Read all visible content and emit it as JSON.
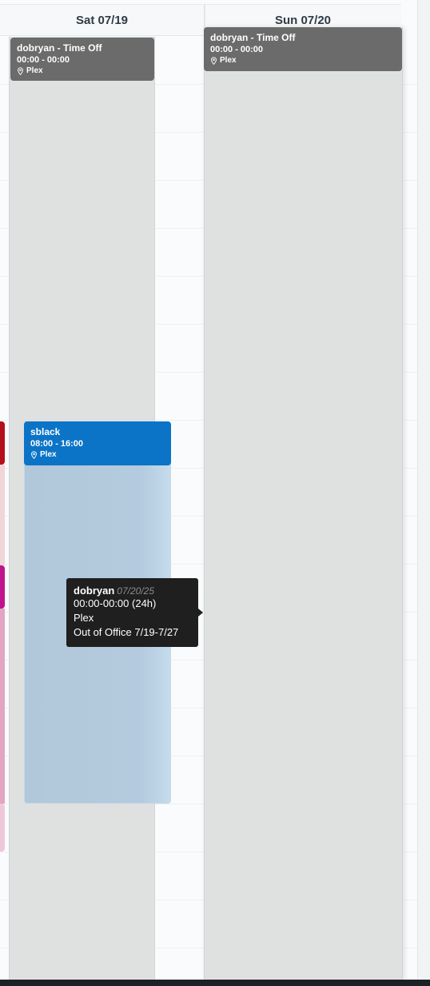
{
  "columns": [
    {
      "label": "Sat 07/19"
    },
    {
      "label": "Sun 07/20"
    }
  ],
  "events": {
    "sat_timeoff": {
      "title": "dobryan - Time Off",
      "time": "00:00 - 00:00",
      "location": "Plex"
    },
    "sun_timeoff": {
      "title": "dobryan - Time Off",
      "time": "00:00 - 00:00",
      "location": "Plex"
    },
    "shift": {
      "title": "sblack",
      "time": "08:00 - 16:00",
      "location": "Plex"
    }
  },
  "tooltip": {
    "name": "dobryan",
    "date": "07/20/25",
    "hours": "00:00-00:00 (24h)",
    "location": "Plex",
    "note": "Out of Office 7/19-7/27"
  },
  "colors": {
    "time_off": "#6b6b6b",
    "shift": "#0b74c7",
    "shift_body": "#b3c9db",
    "edge_red": "#b3101c",
    "edge_magenta": "#c0148e",
    "edge_pink": "#e8a6c5"
  },
  "icons": {
    "location": "map-pin-icon",
    "tooltip_arrow": "arrow-right-icon"
  }
}
